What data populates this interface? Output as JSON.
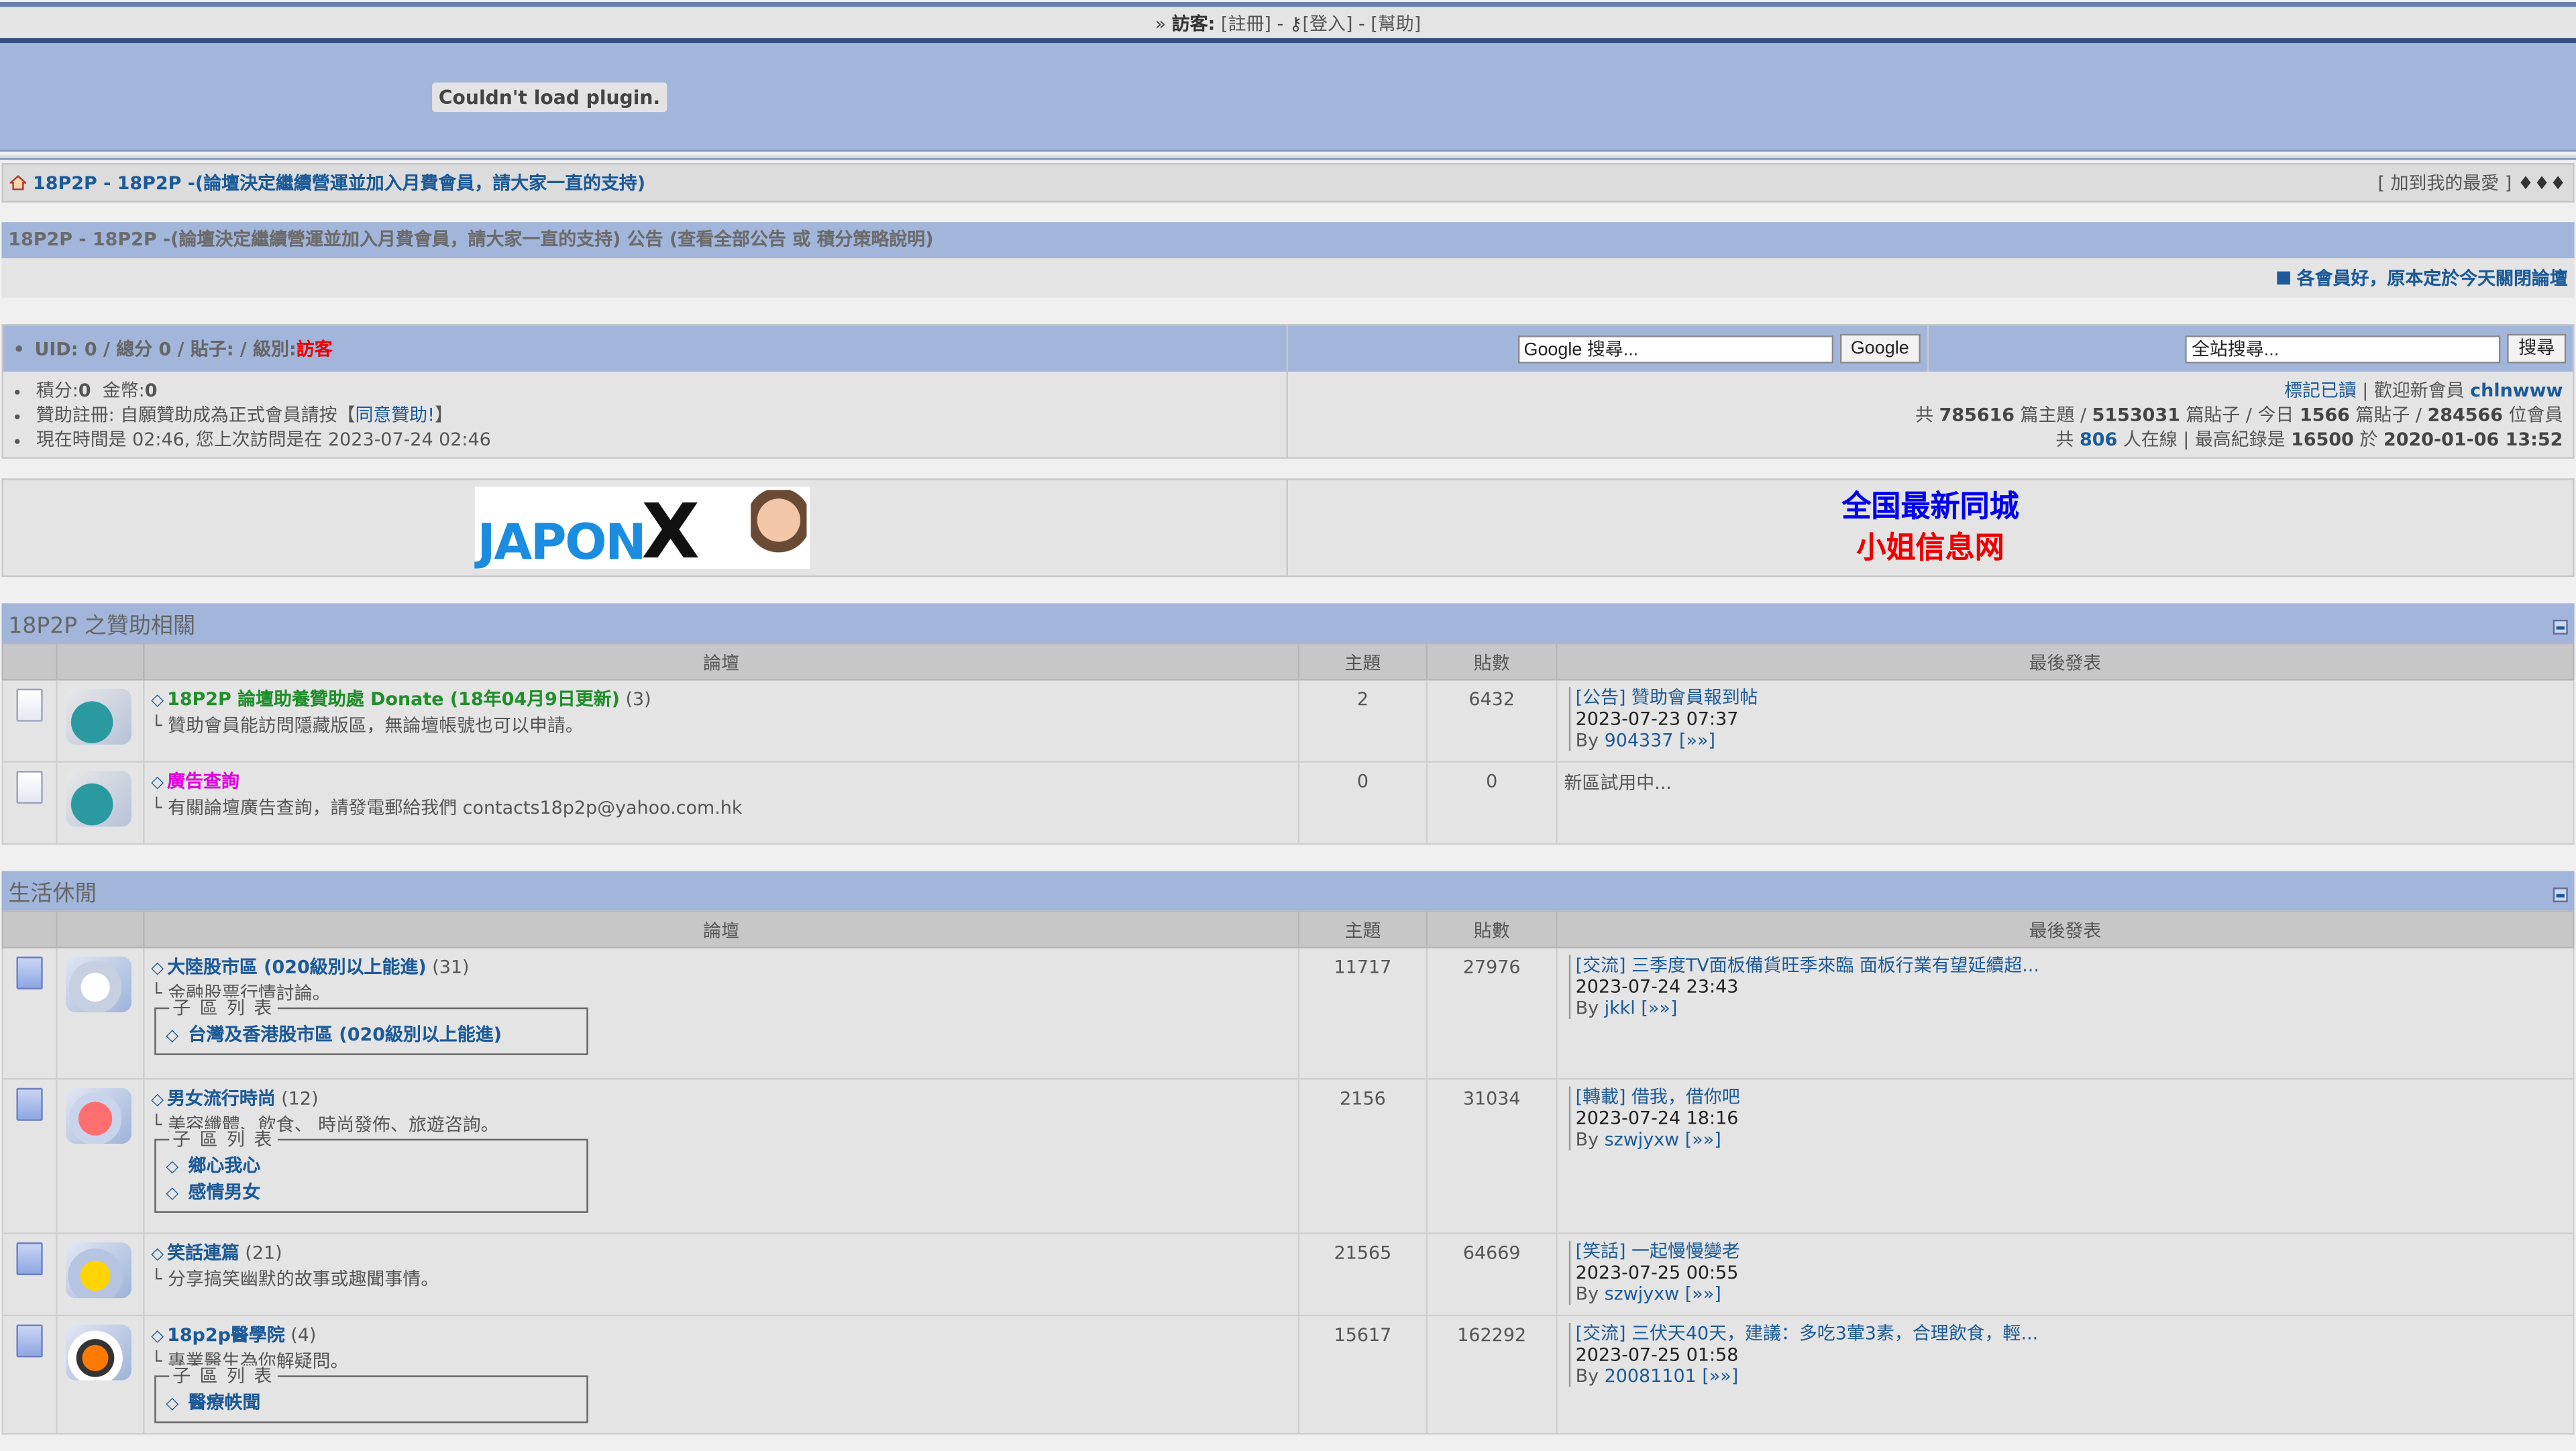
{
  "userbar": {
    "prefix": "» ",
    "visitor_label": "訪客:",
    "register": "[註冊]",
    "sep1": " - ",
    "login_icon": "key-icon",
    "login": "[登入]",
    "sep2": " - ",
    "help": "[幫助]"
  },
  "plugin_message": "Couldn't load plugin.",
  "navbar": {
    "title": "18P2P - 18P2P -(論壇決定繼續營運並加入月費會員，請大家一直的支持)",
    "favorite": "[ 加到我的最愛 ]",
    "more": "♦♦♦"
  },
  "announcement": {
    "head": "18P2P - 18P2P -(論壇決定繼續營運並加入月費會員，請大家一直的支持) 公告 (查看全部公告 或 積分策略說明)",
    "ticker": "各會員好，原本定於今天關閉論壇"
  },
  "user_info": {
    "uid_line_prefix": "UID: 0 / 總分 0 / 貼子: / 級別:",
    "level": "訪客",
    "points_label": "積分:",
    "points_value": "0",
    "coins_label": "金幣:",
    "coins_value": "0",
    "sponsor_text": "贊助註冊: 自願贊助成為正式會員請按【",
    "sponsor_link": "同意贊助!",
    "sponsor_end": "】",
    "time_text": "現在時間是 02:46, 您上次訪問是在 2023-07-24 02:46"
  },
  "search": {
    "google_placeholder": "Google 搜尋...",
    "google_button": "Google",
    "site_placeholder": "全站搜尋...",
    "site_button": "搜尋"
  },
  "stats": {
    "mark_read": "標記已讀",
    "welcome": "歡迎新會員",
    "new_member": "chlnwww",
    "total_prefix": "共",
    "topics": "785616",
    "topics_label": "篇主題 /",
    "posts": "5153031",
    "posts_label": "篇貼子 / 今日",
    "today": "1566",
    "today_label": "篇貼子 /",
    "members": "284566",
    "members_label": "位會員",
    "online_prefix": "共",
    "online": "806",
    "online_label": "人在線 | 最高紀錄是",
    "record": "16500",
    "record_label": "於",
    "record_date": "2020-01-06 13:52"
  },
  "ads": {
    "logo_text": "JAPON",
    "logo_x": "X",
    "line1": "全国最新同城",
    "line2": "小姐信息网"
  },
  "table_headers": {
    "forum": "論壇",
    "topics": "主題",
    "posts": "貼數",
    "last": "最後發表"
  },
  "categories": [
    {
      "title": "18P2P 之贊助相關",
      "forums": [
        {
          "name": "18P2P 論壇助養贊助處 Donate (18年04月9日更新)",
          "count": "(3)",
          "desc": "└ 贊助會員能訪問隱藏版區，無論壇帳號也可以申請。",
          "topics": "2",
          "posts": "6432",
          "last_title": "[公告] 贊助會員報到帖",
          "last_date": "2023-07-23 07:37",
          "last_by_prefix": "By",
          "last_by": "904337",
          "last_more": "[»»]"
        },
        {
          "name": "廣告查詢",
          "desc": "└ 有關論壇廣告查詢，請發電郵給我們 contacts18p2p@yahoo.com.hk",
          "topics": "0",
          "posts": "0",
          "last_plain": "新區試用中..."
        }
      ]
    },
    {
      "title": "生活休閒",
      "forums": [
        {
          "name": "大陸股市區 (020級別以上能進)",
          "count": "(31)",
          "desc": "└ 金融股票行情討論。",
          "sub_legend": "子 區 列 表",
          "subs": [
            "台灣及香港股市區 (020級別以上能進)"
          ],
          "topics": "11717",
          "posts": "27976",
          "last_title": "[交流] 三季度TV面板備貨旺季來臨 面板行業有望延續超...",
          "last_date": "2023-07-24 23:43",
          "last_by_prefix": "By",
          "last_by": "jkkl",
          "last_more": "[»»]"
        },
        {
          "name": "男女流行時尚",
          "count": "(12)",
          "desc": "└ 美容纖體、飲食、 時尚發佈、旅遊咨詢。",
          "sub_legend": "子 區 列 表",
          "subs": [
            "鄉心我心",
            "感情男女"
          ],
          "topics": "2156",
          "posts": "31034",
          "last_title": "[轉載] 借我，借你吧",
          "last_date": "2023-07-24 18:16",
          "last_by_prefix": "By",
          "last_by": "szwjyxw",
          "last_more": "[»»]"
        },
        {
          "name": "笑話連篇",
          "count": "(21)",
          "desc": "└ 分享搞笑幽默的故事或趣聞事情。",
          "topics": "21565",
          "posts": "64669",
          "last_title": "[笑話] 一起慢慢變老",
          "last_date": "2023-07-25 00:55",
          "last_by_prefix": "By",
          "last_by": "szwjyxw",
          "last_more": "[»»]"
        },
        {
          "name": "18p2p醫學院",
          "count": "(4)",
          "desc": "└ 專業醫生為你解疑問。",
          "sub_legend": "子 區 列 表",
          "subs": [
            "醫療帙聞"
          ],
          "topics": "15617",
          "posts": "162292",
          "last_title": "[交流] 三伏天40天，建議：多吃3葷3素，合理飲食，輕...",
          "last_date": "2023-07-25 01:58",
          "last_by_prefix": "By",
          "last_by": "20081101",
          "last_more": "[»»]"
        }
      ]
    }
  ]
}
